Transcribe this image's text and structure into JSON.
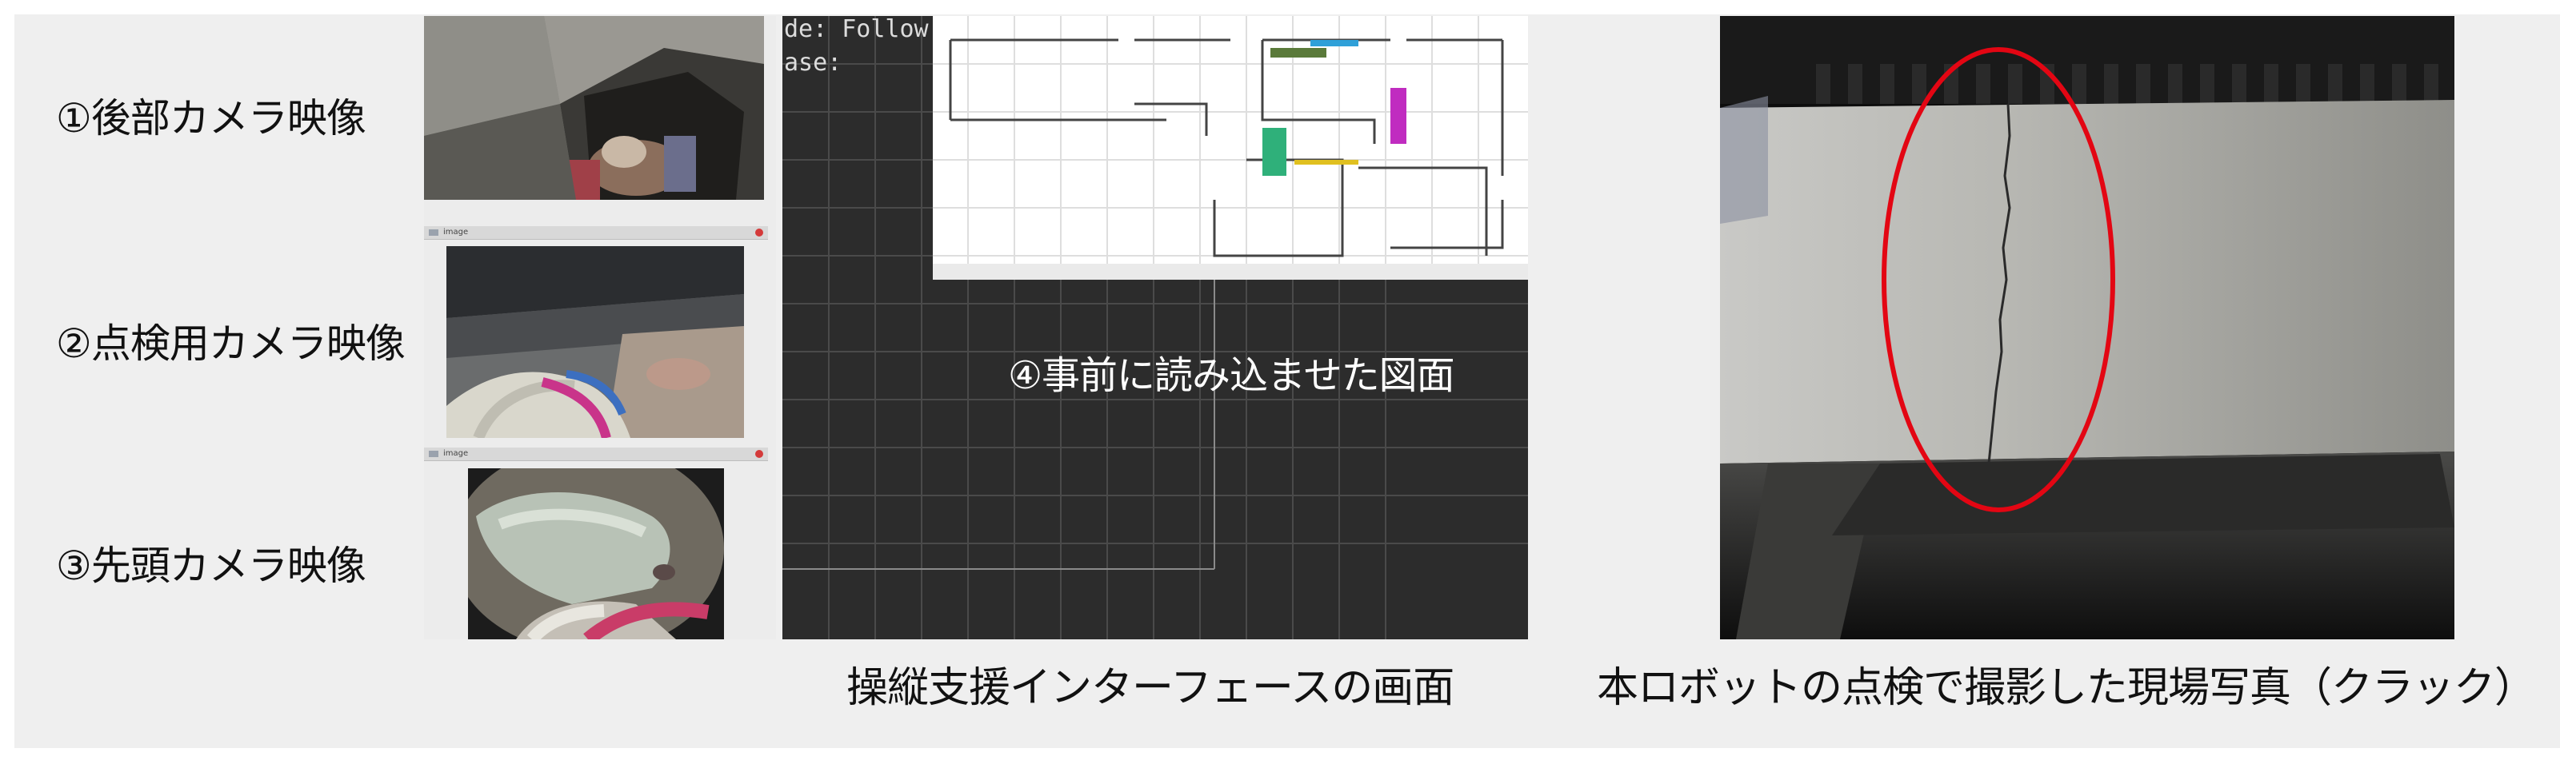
{
  "captions": {
    "rear_camera": "①後部カメラ映像",
    "inspection_camera": "②点検用カメラ映像",
    "front_camera": "③先頭カメラ映像"
  },
  "camera_windows": {
    "window_title": "image"
  },
  "map_panel": {
    "mode_text": "de:  Follow",
    "phase_text": "ase:",
    "overlay_label": "④事前に読み込ませた図面"
  },
  "bottom_labels": {
    "interface_caption": "操縦支援インターフェースの画面",
    "photo_caption": "本ロボットの点検で撮影した現場写真（クラック）"
  },
  "colors": {
    "background": "#efefef",
    "crack_marker": "#e30613",
    "map_background": "#2c2c2c",
    "map_grid": "#4a4a4a"
  },
  "icons": {
    "window_close": "close-icon",
    "window_app": "image-icon"
  }
}
